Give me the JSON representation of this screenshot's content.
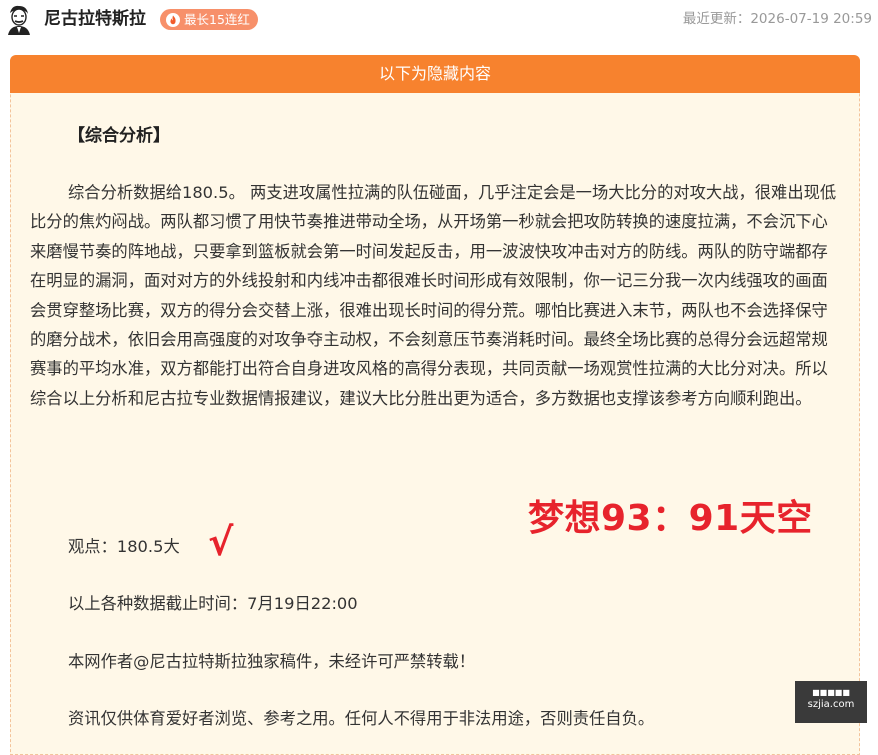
{
  "header": {
    "author_name": "尼古拉特斯拉",
    "streak_badge": "最长15连红",
    "updated": "最近更新：2026-07-19 20:59"
  },
  "hidden_section": {
    "title": "以下为隐藏内容"
  },
  "article": {
    "heading": "【综合分析】",
    "paragraph": "综合分析数据给180.5。 两支进攻属性拉满的队伍碰面，几乎注定会是一场大比分的对攻大战，很难出现低比分的焦灼闷战。两队都习惯了用快节奏推进带动全场，从开场第一秒就会把攻防转换的速度拉满，不会沉下心来磨慢节奏的阵地战，只要拿到篮板就会第一时间发起反击，用一波波快攻冲击对方的防线。两队的防守端都存在明显的漏洞，面对对方的外线投射和内线冲击都很难长时间形成有效限制，你一记三分我一次内线强攻的画面会贯穿整场比赛，双方的得分会交替上涨，很难出现长时间的得分荒。哪怕比赛进入末节，两队也不会选择保守的磨分战术，依旧会用高强度的对攻争夺主动权，不会刻意压节奏消耗时间。最终全场比赛的总得分会远超常规赛事的平均水准，双方都能打出符合自身进攻风格的高得分表现，共同贡献一场观赏性拉满的大比分对决。所以综合以上分析和尼古拉专业数据情报建议，建议大比分胜出更为适合，多方数据也支撑该参考方向顺利跑出。",
    "viewpoint": "观点：180.5大",
    "check_mark": "√",
    "dream_stamp": "梦想93：91天空",
    "cutoff": "以上各种数据截止时间：7月19日22:00",
    "copyright": "本网作者@尼古拉特斯拉独家稿件，未经许可严禁转载！",
    "disclaimer": "资讯仅供体育爱好者浏览、参考之用。任何人不得用于非法用途，否则责任自负。"
  },
  "watermark": {
    "top": "■■■■■",
    "site": "szjia.com"
  },
  "colors": {
    "accent_orange": "#f7822e",
    "badge_orange": "#f7906a",
    "stamp_red": "#e7232c",
    "hidden_bg": "#fff8e8"
  },
  "icons": {
    "avatar": "tesla-portrait-avatar",
    "streak": "fire-icon"
  }
}
